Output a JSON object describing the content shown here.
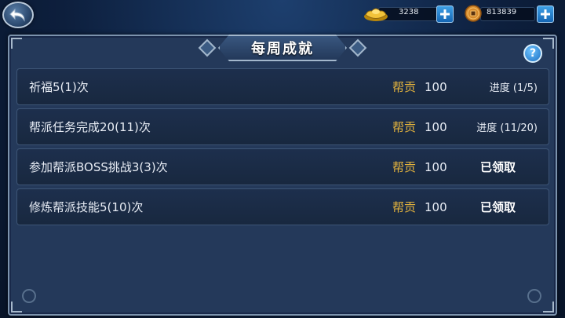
{
  "currency": {
    "gold": {
      "icon": "gold-ingot-icon",
      "value": "3238"
    },
    "coin": {
      "icon": "copper-coin-icon",
      "value": "813839"
    }
  },
  "panel": {
    "title": "每周成就",
    "help_label": "?"
  },
  "achievements": [
    {
      "task": "祈福5(1)次",
      "reward_label": "帮贡",
      "reward_value": "100",
      "status": "进度 (1/5)"
    },
    {
      "task": "帮派任务完成20(11)次",
      "reward_label": "帮贡",
      "reward_value": "100",
      "status": "进度 (11/20)"
    },
    {
      "task": "参加帮派BOSS挑战3(3)次",
      "reward_label": "帮贡",
      "reward_value": "100",
      "status": "已领取"
    },
    {
      "task": "修炼帮派技能5(10)次",
      "reward_label": "帮贡",
      "reward_value": "100",
      "status": "已领取"
    }
  ],
  "colors": {
    "accent_gold": "#e3b33d",
    "panel_bg": "#24395a",
    "row_bg": "#1d2f4d"
  }
}
